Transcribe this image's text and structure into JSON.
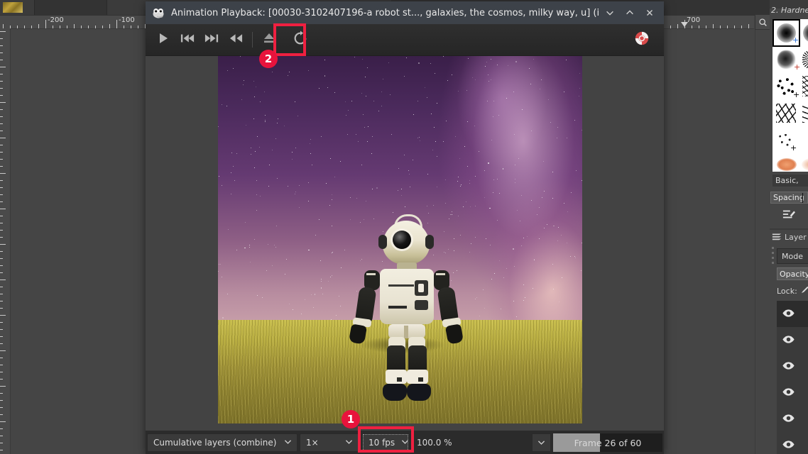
{
  "window": {
    "title": "Animation Playback: [00030-3102407196-a robot st..., galaxies, the cosmos, milky way, u] (imported)",
    "app_icon": "gimp-wilber-icon",
    "controls": {
      "minimize": "chevron-down-icon",
      "maximize": "chevron-up-icon",
      "close": "close-x-icon"
    }
  },
  "toolbar": {
    "play": "play-icon",
    "step_back": "step-back-icon",
    "step_forward": "step-forward-icon",
    "rewind": "rewind-icon",
    "detach": "detach-icon",
    "refresh": "refresh-icon",
    "help": "lifebuoy-help-icon"
  },
  "bottom_bar": {
    "blend_mode": "Cumulative layers (combine)",
    "blend_caret": "chevron-down-icon",
    "speed": "1×",
    "speed_caret": "chevron-down-icon",
    "fps": "10 fps",
    "fps_caret": "chevron-down-icon",
    "zoom_percent": "100.0 %",
    "zoom_caret": "chevron-down-icon",
    "frame_status": "Frame 26 of 60",
    "progress_value": 43
  },
  "rulers": {
    "horizontal_labels": [
      "-200",
      "-100",
      "700"
    ],
    "zoom_corner_icon": "zoom-icon"
  },
  "right_dock": {
    "brushes_title": "2. Hardne",
    "brush_set": "Basic,",
    "spacing_label": "Spacing",
    "edit_brush_icon": "edit-brush-icon",
    "layers_title": "Layer",
    "layers_icon": "layers-icon",
    "mode_label": "Mode",
    "opacity_label": "Opacity",
    "lock_label": "Lock:",
    "lock_icon": "brush-lock-icon",
    "layer_rows": [
      {
        "visibility_icon": "eye-icon",
        "active": true
      },
      {
        "visibility_icon": "eye-icon",
        "active": false
      },
      {
        "visibility_icon": "eye-icon",
        "active": false
      },
      {
        "visibility_icon": "eye-icon",
        "active": false
      },
      {
        "visibility_icon": "eye-icon",
        "active": false
      },
      {
        "visibility_icon": "eye-icon",
        "active": false
      }
    ]
  },
  "annotations": [
    {
      "id": "1",
      "label": "1",
      "target": "fps-combo"
    },
    {
      "id": "2",
      "label": "2",
      "target": "refresh-button"
    }
  ],
  "colors": {
    "annotation_red": "#e8133c",
    "highlight_red": "#ef2040",
    "titlebar": "#3d4249",
    "toolbar": "#2b2b2b",
    "app_bg": "#454545"
  }
}
